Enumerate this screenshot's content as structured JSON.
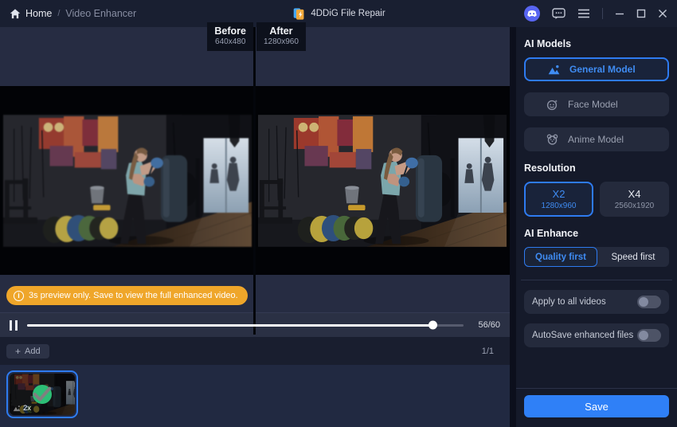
{
  "titlebar": {
    "home": "Home",
    "breadcrumb_separator": "/",
    "section": "Video Enhancer",
    "app_title": "4DDiG File Repair"
  },
  "preview": {
    "before": {
      "label": "Before",
      "resolution": "640x480"
    },
    "after": {
      "label": "After",
      "resolution": "1280x960"
    },
    "notice": "3s preview only. Save to view the full enhanced video.",
    "notice_icon": "i",
    "time": "56/60",
    "progress_percent": 93
  },
  "playlist": {
    "add_icon": "+",
    "add_button": "Add",
    "counter": "1/1",
    "thumbnail": {
      "scale_badge": "2x",
      "status": "enhanced-done"
    }
  },
  "panel": {
    "ai_models": {
      "heading": "AI Models",
      "options": [
        {
          "label": "General Model",
          "icon": "mountain-icon",
          "selected": true
        },
        {
          "label": "Face Model",
          "icon": "face-icon",
          "selected": false
        },
        {
          "label": "Anime Model",
          "icon": "anime-icon",
          "selected": false
        }
      ]
    },
    "resolution": {
      "heading": "Resolution",
      "options": [
        {
          "label": "X2",
          "sub": "1280x960",
          "selected": true
        },
        {
          "label": "X4",
          "sub": "2560x1920",
          "selected": false
        }
      ]
    },
    "ai_enhance": {
      "heading": "AI Enhance",
      "options": [
        {
          "label": "Quality first",
          "selected": true
        },
        {
          "label": "Speed first",
          "selected": false
        }
      ]
    },
    "toggles": [
      {
        "label": "Apply to all videos",
        "on": false
      },
      {
        "label": "AutoSave enhanced files",
        "on": false
      }
    ],
    "save_button": "Save"
  },
  "colors": {
    "accent_blue": "#2e7bf0",
    "save_blue": "#2f80f7",
    "banner_orange": "#efa62a",
    "success_green": "#2dbe76",
    "discord_purple": "#5865f2"
  }
}
